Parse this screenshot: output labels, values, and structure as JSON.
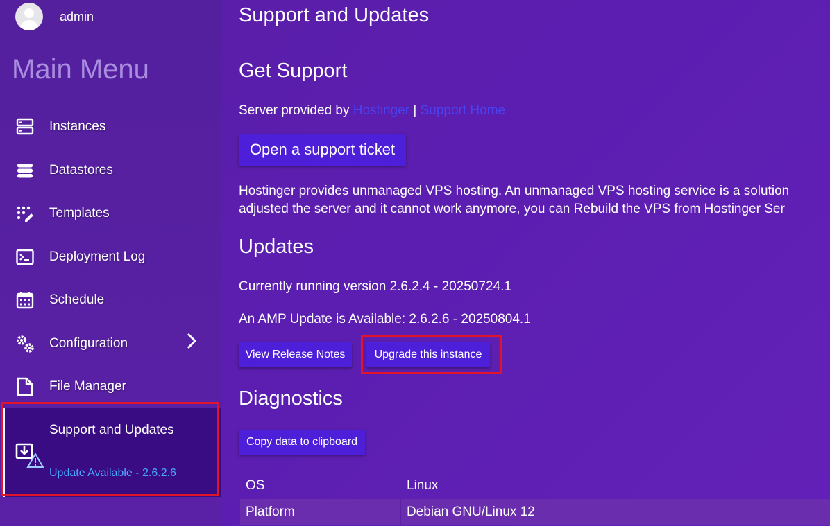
{
  "user": {
    "name": "admin"
  },
  "sidebar": {
    "title": "Main Menu",
    "items": [
      {
        "label": "Instances",
        "icon": "server-icon"
      },
      {
        "label": "Datastores",
        "icon": "database-icon"
      },
      {
        "label": "Templates",
        "icon": "templates-icon"
      },
      {
        "label": "Deployment Log",
        "icon": "terminal-icon"
      },
      {
        "label": "Schedule",
        "icon": "calendar-icon"
      },
      {
        "label": "Configuration",
        "icon": "gears-icon"
      },
      {
        "label": "File Manager",
        "icon": "file-icon"
      }
    ],
    "active": {
      "label": "Support and Updates",
      "sublabel": "Update Available - 2.6.2.6",
      "icon": "download-warning-icon"
    }
  },
  "main": {
    "title": "Support and Updates",
    "support": {
      "heading": "Get Support",
      "provided_prefix": "Server provided by",
      "provider_link": "Hostinger",
      "separator": "|",
      "home_link": "Support Home",
      "ticket_button": "Open a support ticket",
      "desc_line1": "Hostinger provides unmanaged VPS hosting. An unmanaged VPS hosting service is a solution",
      "desc_line2": "adjusted the server and it cannot work anymore, you can Rebuild the VPS from Hostinger Ser"
    },
    "updates": {
      "heading": "Updates",
      "current": "Currently running version 2.6.2.4 - 20250724.1",
      "available": "An AMP Update is Available: 2.6.2.6 - 20250804.1",
      "release_notes_button": "View Release Notes",
      "upgrade_button": "Upgrade this instance"
    },
    "diagnostics": {
      "heading": "Diagnostics",
      "copy_button": "Copy data to clipboard",
      "rows": [
        {
          "key": "OS",
          "value": "Linux"
        },
        {
          "key": "Platform",
          "value": "Debian GNU/Linux 12"
        }
      ]
    }
  },
  "colors": {
    "accent": "#4e1fd9",
    "highlight": "#e0142b",
    "link": "#4a42f0",
    "update": "#4aa8ff"
  }
}
